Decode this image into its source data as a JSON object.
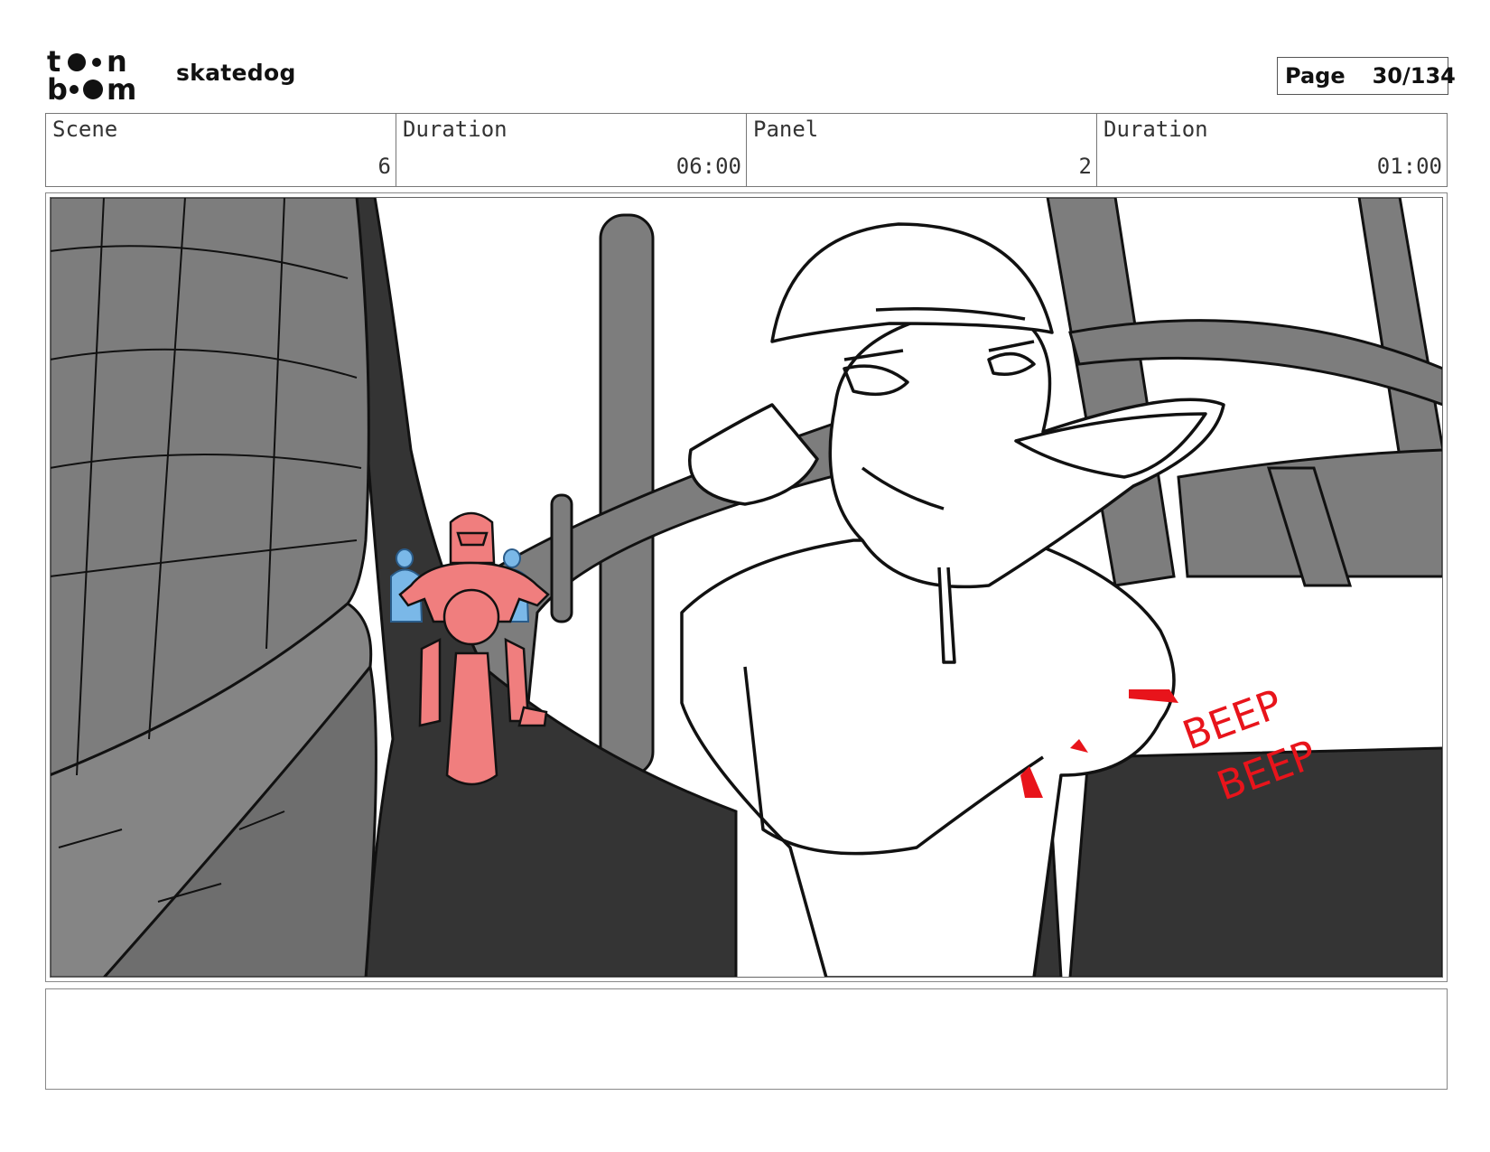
{
  "header": {
    "logo_text_top": "toon",
    "logo_text_bottom": "boom",
    "project_name": "skatedog",
    "page_label": "Page",
    "page_number": "30/134"
  },
  "info": {
    "scene_label": "Scene",
    "scene_value": "6",
    "scene_duration_label": "Duration",
    "scene_duration_value": "06:00",
    "panel_label": "Panel",
    "panel_value": "2",
    "panel_duration_label": "Duration",
    "panel_duration_value": "01:00"
  },
  "artwork": {
    "sfx_line1": "BEEP",
    "sfx_line2": "BEEP",
    "colors": {
      "building_gray": "#7d7d7d",
      "road_dark": "#343434",
      "sky": "#ffffff",
      "rider_red": "#f07e7e",
      "rider_blue": "#7ab8e8",
      "sfx_red": "#e8141b"
    }
  },
  "notes": {
    "text": ""
  }
}
